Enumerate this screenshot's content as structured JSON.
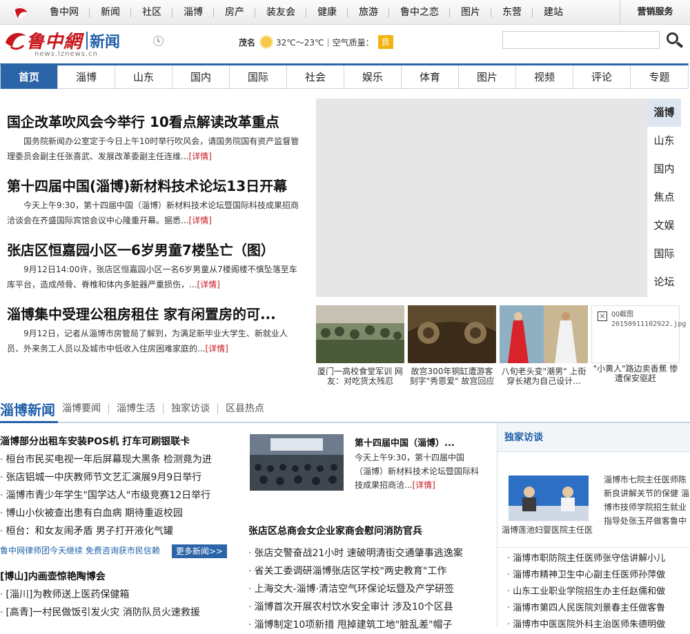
{
  "topnav": [
    "鲁中网",
    "新闻",
    "社区",
    "淄博",
    "房产",
    "装友会",
    "健康",
    "旅游",
    "鲁中之恋",
    "图片",
    "东营",
    "建站"
  ],
  "service": "营销服务",
  "brand": {
    "cn": "鲁中網",
    "sub": "新闻",
    "domain": "news.lznews.cn"
  },
  "weather": {
    "city": "茂名",
    "temp": "32℃～23℃",
    "sep": "|",
    "aq_label": "空气质量：",
    "aq_value": "良"
  },
  "search": {
    "value": ""
  },
  "mainnav": [
    {
      "label": "首页",
      "active": true
    },
    {
      "label": "淄博"
    },
    {
      "label": "山东"
    },
    {
      "label": "国内"
    },
    {
      "label": "国际"
    },
    {
      "label": "社会"
    },
    {
      "label": "娱乐"
    },
    {
      "label": "体育"
    },
    {
      "label": "图片"
    },
    {
      "label": "视频"
    },
    {
      "label": "评论"
    },
    {
      "label": "专题"
    }
  ],
  "headlines": [
    {
      "title": "国企改革吹风会今举行 10看点解读改革重点",
      "summary": "国务院新闻办公室定于今日上午10时举行吹风会，请国务院国有资产监督管理委员会副主任张喜武、发展改革委副主任连维...",
      "more": "[详情]"
    },
    {
      "title": "第十四届中国(淄博)新材料技术论坛13日开幕",
      "summary": "今天上午9:30，第十四届中国（淄博）新材料技术论坛暨国际科技成果招商洽谈会在齐盛国际宾馆会议中心隆重开幕。据悉...",
      "more": "[详情]"
    },
    {
      "title": "张店区恒嘉园小区一6岁男童7楼坠亡（图）",
      "summary": "9月12日14:00许，张店区恒嘉园小区一名6岁男童从7楼阁楼不慎坠落至车库平台，造成颅骨、脊椎和体内多脏器严重损伤，...",
      "more": "[详情]"
    },
    {
      "title": "淄博集中受理公租房租住 家有闲置房的可...",
      "summary": "9月12日，记者从淄博市房管局了解到，为满足新毕业大学生、新就业人员、外来务工人员以及城市中低收入住房困难家庭的...",
      "more": "[详情]"
    }
  ],
  "side_tabs": [
    "淄博",
    "山东",
    "国内",
    "焦点",
    "文娱",
    "国际",
    "论坛"
  ],
  "thumbs": [
    {
      "caption": "厦门一高校食堂军训 网友：对吃货太残忍"
    },
    {
      "caption": "故宫300年铜缸遭游客刻字\"秀恩爱\" 故宫回应"
    },
    {
      "caption": "八旬老头变\"潮男\" 上街穿长裙为自己设计..."
    },
    {
      "caption": "\"小黄人\"路边卖香蕉 惨遭保安驱赶",
      "broken_alt": "QQ截图20150911102922.jpg"
    }
  ],
  "zibo": {
    "title": "淄博新闻",
    "links": [
      "淄博要闻",
      "淄博生活",
      "独家访谈",
      "区县热点"
    ],
    "lead": "淄博部分出租车安装POS机 打车可刷银联卡",
    "items": [
      "桓台市民买电视一年后屏幕现大黑条 检测竟为进",
      "张店铝城一中庆教师节文艺汇演展9月9日举行",
      "淄博市青少年学生\"国学达人\"市级竞赛12日举行",
      "博山小伙被查出患有白血病 期待重返校园",
      "桓台：和女友闹矛盾 男子打开液化气罐"
    ],
    "promo": "鲁中网律师团今天继续 免费咨询获市民信赖",
    "more_btn": "更多新闻>>",
    "sub_title": "[博山]内画壶惊艳陶博会",
    "sub_items": [
      "[淄川]为教师送上医药保健箱",
      "[高青]一村民做饭引发火灾 消防队员火速救援"
    ]
  },
  "feature": {
    "title": "第十四届中国（淄博）...",
    "text": "今天上午9:30，第十四届中国（淄博）新材料技术论坛暨国际科技成果招商洽...",
    "more": "[详情]",
    "section2_title": "张店区总商会女企业家商会慰问消防官兵",
    "items": [
      "张店交警奋战21小时 速破明清街交通肇事逃逸案",
      "省关工委调研淄博张店区学校\"两史教育\"工作",
      "上海交大-淄博·清洁空气环保论坛暨及产学研签",
      "淄博首次开展农村饮水安全审计 涉及10个区县",
      "淄博制定10项新措 甩掉建筑工地\"脏乱差\"帽子"
    ]
  },
  "interview": {
    "head": "独家访谈",
    "img_caption": "淄博莲池妇婴医院主任医",
    "text": "淄博市七院主任医师陈新良讲解关节的保健 淄博市技师学院招生就业指导处张玉芹做客鲁中网",
    "items": [
      "淄博市职防院主任医师张守信讲解小儿",
      "淄博市精神卫生中心副主任医师孙萍做",
      "山东工业职业学院招生办主任赵儒和做",
      "淄博市第四人民医院刘景春主任做客鲁",
      "淄博市中医医院外科主治医师朱德明做"
    ]
  }
}
